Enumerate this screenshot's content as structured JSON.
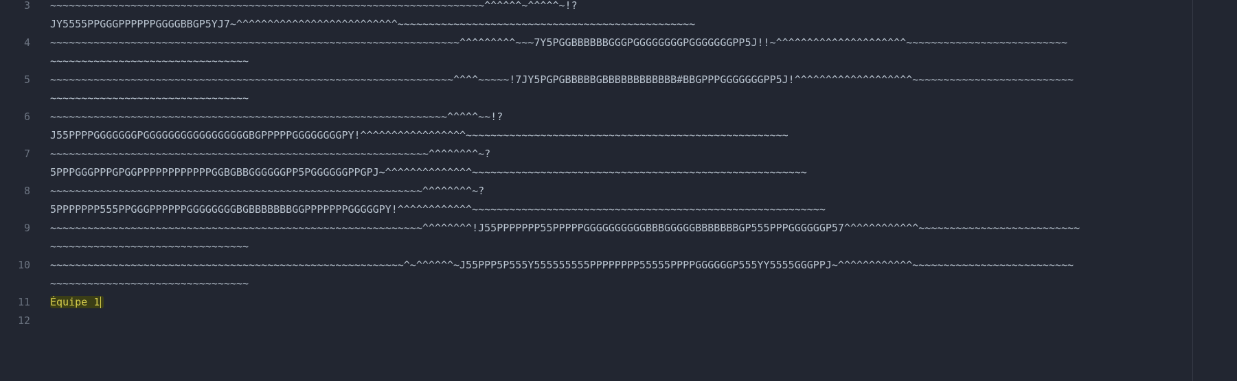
{
  "editor": {
    "lines": [
      {
        "number": "3",
        "rows": [
          "~~~~~~~~~~~~~~~~~~~~~~~~~~~~~~~~~~~~~~~~~~~~~~~~~~~~~~~~~~~~~~~~~~~~~~^^^^^^~^^^^^~!?",
          "JY5555PPGGGPPPPPPGGGGBBGP5YJ7~^^^^^^^^^^^^^^^^^^^^^^^^^^~~~~~~~~~~~~~~~~~~~~~~~~~~~~~~~~~~~~~~~~~~~~~~~~"
        ]
      },
      {
        "number": "4",
        "rows": [
          "~~~~~~~~~~~~~~~~~~~~~~~~~~~~~~~~~~~~~~~~~~~~~~~~~~~~~~~~~~~~~~~~~~^^^^^^^^^~~~7Y5PGGBBBBBBGGGPGGGGGGGGPGGGGGGGPP5J!!~^^^^^^^^^^^^^^^^^^^^^~~~~~~~~~~~~~~~~~~~~~~~~~~",
          "~~~~~~~~~~~~~~~~~~~~~~~~~~~~~~~~"
        ]
      },
      {
        "number": "5",
        "rows": [
          "~~~~~~~~~~~~~~~~~~~~~~~~~~~~~~~~~~~~~~~~~~~~~~~~~~~~~~~~~~~~~~~~~^^^^~~~~~!7JY5PGPGBBBBBGBBBBBBBBBBBB#BBGPPPGGGGGGGPP5J!^^^^^^^^^^^^^^^^^^^~~~~~~~~~~~~~~~~~~~~~~~~~~",
          "~~~~~~~~~~~~~~~~~~~~~~~~~~~~~~~~"
        ]
      },
      {
        "number": "6",
        "rows": [
          "~~~~~~~~~~~~~~~~~~~~~~~~~~~~~~~~~~~~~~~~~~~~~~~~~~~~~~~~~~~~~~~~^^^^^~~!?",
          "J55PPPPGGGGGGGPGGGGGGGGGGGGGGGGGBGPPPPPGGGGGGGGPY!^^^^^^^^^^^^^^^^^~~~~~~~~~~~~~~~~~~~~~~~~~~~~~~~~~~~~~~~~~~~~~~~~~~~~"
        ]
      },
      {
        "number": "7",
        "rows": [
          "~~~~~~~~~~~~~~~~~~~~~~~~~~~~~~~~~~~~~~~~~~~~~~~~~~~~~~~~~~~~~^^^^^^^^~?",
          "5PPPGGGPPPGPGGPPPPPPPPPPPPGGBGBBGGGGGGPP5PGGGGGGPPGPJ~^^^^^^^^^^^^^^~~~~~~~~~~~~~~~~~~~~~~~~~~~~~~~~~~~~~~~~~~~~~~~~~~~~~~"
        ]
      },
      {
        "number": "8",
        "rows": [
          "~~~~~~~~~~~~~~~~~~~~~~~~~~~~~~~~~~~~~~~~~~~~~~~~~~~~~~~~~~~~^^^^^^^^~?",
          "5PPPPPPP555PPGGGPPPPPPGGGGGGGGBGBBBBBBBGGPPPPPPPGGGGGPY!^^^^^^^^^^^^~~~~~~~~~~~~~~~~~~~~~~~~~~~~~~~~~~~~~~~~~~~~~~~~~~~~~~~~~"
        ]
      },
      {
        "number": "9",
        "rows": [
          "~~~~~~~~~~~~~~~~~~~~~~~~~~~~~~~~~~~~~~~~~~~~~~~~~~~~~~~~~~~~^^^^^^^^!J55PPPPPPP55PPPPPGGGGGGGGGGBBBGGGGGBBBBBBBGP555PPPGGGGGGP57^^^^^^^^^^^^~~~~~~~~~~~~~~~~~~~~~~~~~~",
          "~~~~~~~~~~~~~~~~~~~~~~~~~~~~~~~~"
        ]
      },
      {
        "number": "10",
        "rows": [
          "~~~~~~~~~~~~~~~~~~~~~~~~~~~~~~~~~~~~~~~~~~~~~~~~~~~~~~~~~^~^^^^^^~J55PPP5P555Y555555555PPPPPPPP55555PPPPGGGGGGP555YY5555GGGPPJ~^^^^^^^^^^^^~~~~~~~~~~~~~~~~~~~~~~~~~~",
          "~~~~~~~~~~~~~~~~~~~~~~~~~~~~~~~~"
        ]
      },
      {
        "number": "11",
        "rows": [
          "Équipe 1"
        ]
      },
      {
        "number": "12",
        "rows": [
          ""
        ]
      }
    ]
  }
}
